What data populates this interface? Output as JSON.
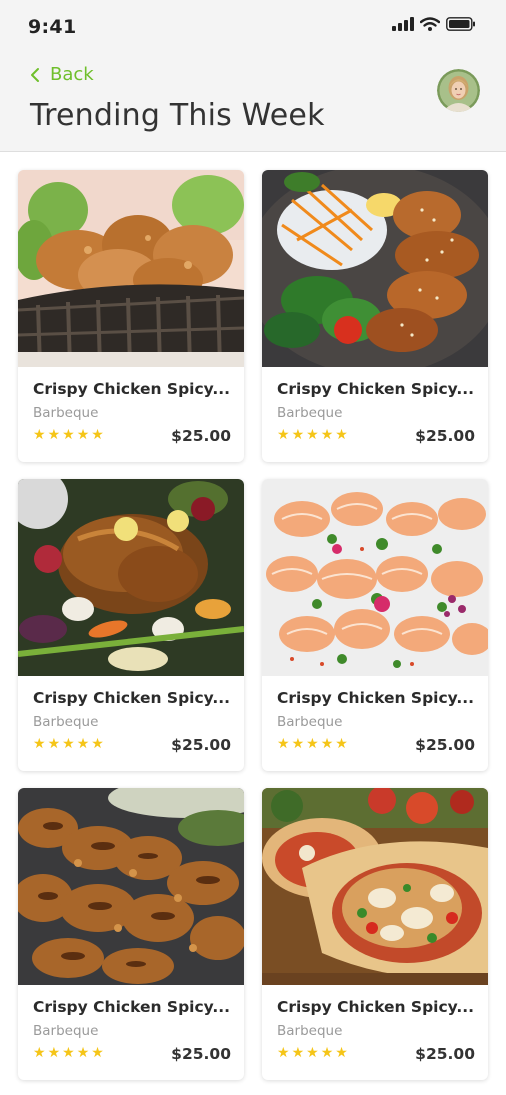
{
  "status_bar": {
    "time": "9:41"
  },
  "header": {
    "back_label": "Back",
    "title": "Trending This Week",
    "accent_color": "#6fbf2b"
  },
  "cards": [
    {
      "name": "Crispy Chicken Spicy...",
      "category": "Barbeque",
      "rating": 5,
      "price": "$25.00",
      "image": "fried-chicken-basket"
    },
    {
      "name": "Crispy Chicken Spicy...",
      "category": "Barbeque",
      "rating": 5,
      "price": "$25.00",
      "image": "sesame-chicken-salad"
    },
    {
      "name": "Crispy Chicken Spicy...",
      "category": "Barbeque",
      "rating": 5,
      "price": "$25.00",
      "image": "roast-chicken-vegetables"
    },
    {
      "name": "Crispy Chicken Spicy...",
      "category": "Barbeque",
      "rating": 5,
      "price": "$25.00",
      "image": "shrimp-platter"
    },
    {
      "name": "Crispy Chicken Spicy...",
      "category": "Barbeque",
      "rating": 5,
      "price": "$25.00",
      "image": "grilled-chicken-wings"
    },
    {
      "name": "Crispy Chicken Spicy...",
      "category": "Barbeque",
      "rating": 5,
      "price": "$25.00",
      "image": "chicken-wrap"
    }
  ]
}
